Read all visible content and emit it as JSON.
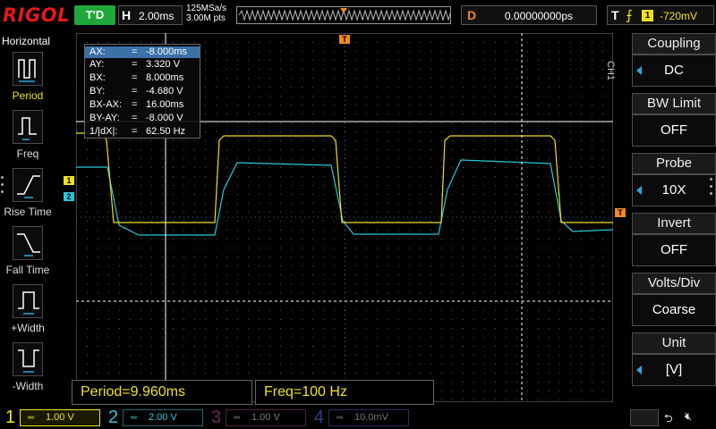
{
  "topbar": {
    "brand": "RIGOL",
    "run_state": "T'D",
    "horizontal_label": "H",
    "timebase": "2.00ms",
    "sample_rate": "125MSa/s",
    "memory_depth": "3.00M pts",
    "delay_label": "D",
    "delay_value": "0.00000000ps",
    "trigger_label": "T",
    "trigger_source": "1",
    "trigger_level": "-720mV"
  },
  "left_menu": {
    "title": "Horizontal",
    "items": [
      {
        "label": "Period",
        "icon": "period-icon",
        "selected": true
      },
      {
        "label": "Freq",
        "icon": "frequency-icon",
        "selected": false
      },
      {
        "label": "Rise Time",
        "icon": "rise-time-icon",
        "selected": false
      },
      {
        "label": "Fall Time",
        "icon": "fall-time-icon",
        "selected": false
      },
      {
        "label": "+Width",
        "icon": "positive-width-icon",
        "selected": false
      },
      {
        "label": "-Width",
        "icon": "negative-width-icon",
        "selected": false
      }
    ]
  },
  "cursor_readout": {
    "rows": [
      {
        "name": "AX:",
        "value": "-8.000ms",
        "selected": true
      },
      {
        "name": "AY:",
        "value": "3.320 V",
        "selected": false
      },
      {
        "name": "BX:",
        "value": "8.000ms",
        "selected": false
      },
      {
        "name": "BY:",
        "value": "-4.680 V",
        "selected": false
      },
      {
        "name": "BX-AX:",
        "value": "16.00ms",
        "selected": false
      },
      {
        "name": "BY-AY:",
        "value": "-8.000 V",
        "selected": false
      },
      {
        "name": "1/|dX|:",
        "value": "62.50 Hz",
        "selected": false
      }
    ],
    "equals": "="
  },
  "screen": {
    "ch1_marker": "1",
    "ch2_marker": "2",
    "trigger_marker": "T"
  },
  "measurements": {
    "period": "Period=9.960ms",
    "freq": "Freq=100 Hz"
  },
  "right_menu": {
    "channel_label": "CH1",
    "items": [
      {
        "title": "Coupling",
        "value": "DC",
        "has_arrow": true
      },
      {
        "title": "BW Limit",
        "value": "OFF",
        "has_arrow": false
      },
      {
        "title": "Probe",
        "value": "10X",
        "has_arrow": true
      },
      {
        "title": "Invert",
        "value": "OFF",
        "has_arrow": false
      },
      {
        "title": "Volts/Div",
        "value": "Coarse",
        "has_arrow": false
      },
      {
        "title": "Unit",
        "value": "[V]",
        "has_arrow": true
      }
    ]
  },
  "bottombar": {
    "channels": [
      {
        "num": "1",
        "coupling": "═",
        "scale": "1.00 V",
        "color": "#f0e020"
      },
      {
        "num": "2",
        "coupling": "═",
        "scale": "2.00 V",
        "color": "#28c8d8"
      },
      {
        "num": "3",
        "coupling": "═",
        "scale": "1.00 V",
        "color": "#c040b0"
      },
      {
        "num": "4",
        "coupling": "═",
        "scale": "10.0mV",
        "color": "#3060d0"
      }
    ],
    "usb_icon": "usb-icon",
    "speaker_icon": "speaker-muted-icon"
  },
  "colors": {
    "ch1": "#f0e020",
    "ch2": "#28c8d8",
    "ch3": "#c040b0",
    "ch4": "#3060d0",
    "trigger": "#f28a1c",
    "brand": "#e21a1a",
    "run": "#1ea83a"
  }
}
